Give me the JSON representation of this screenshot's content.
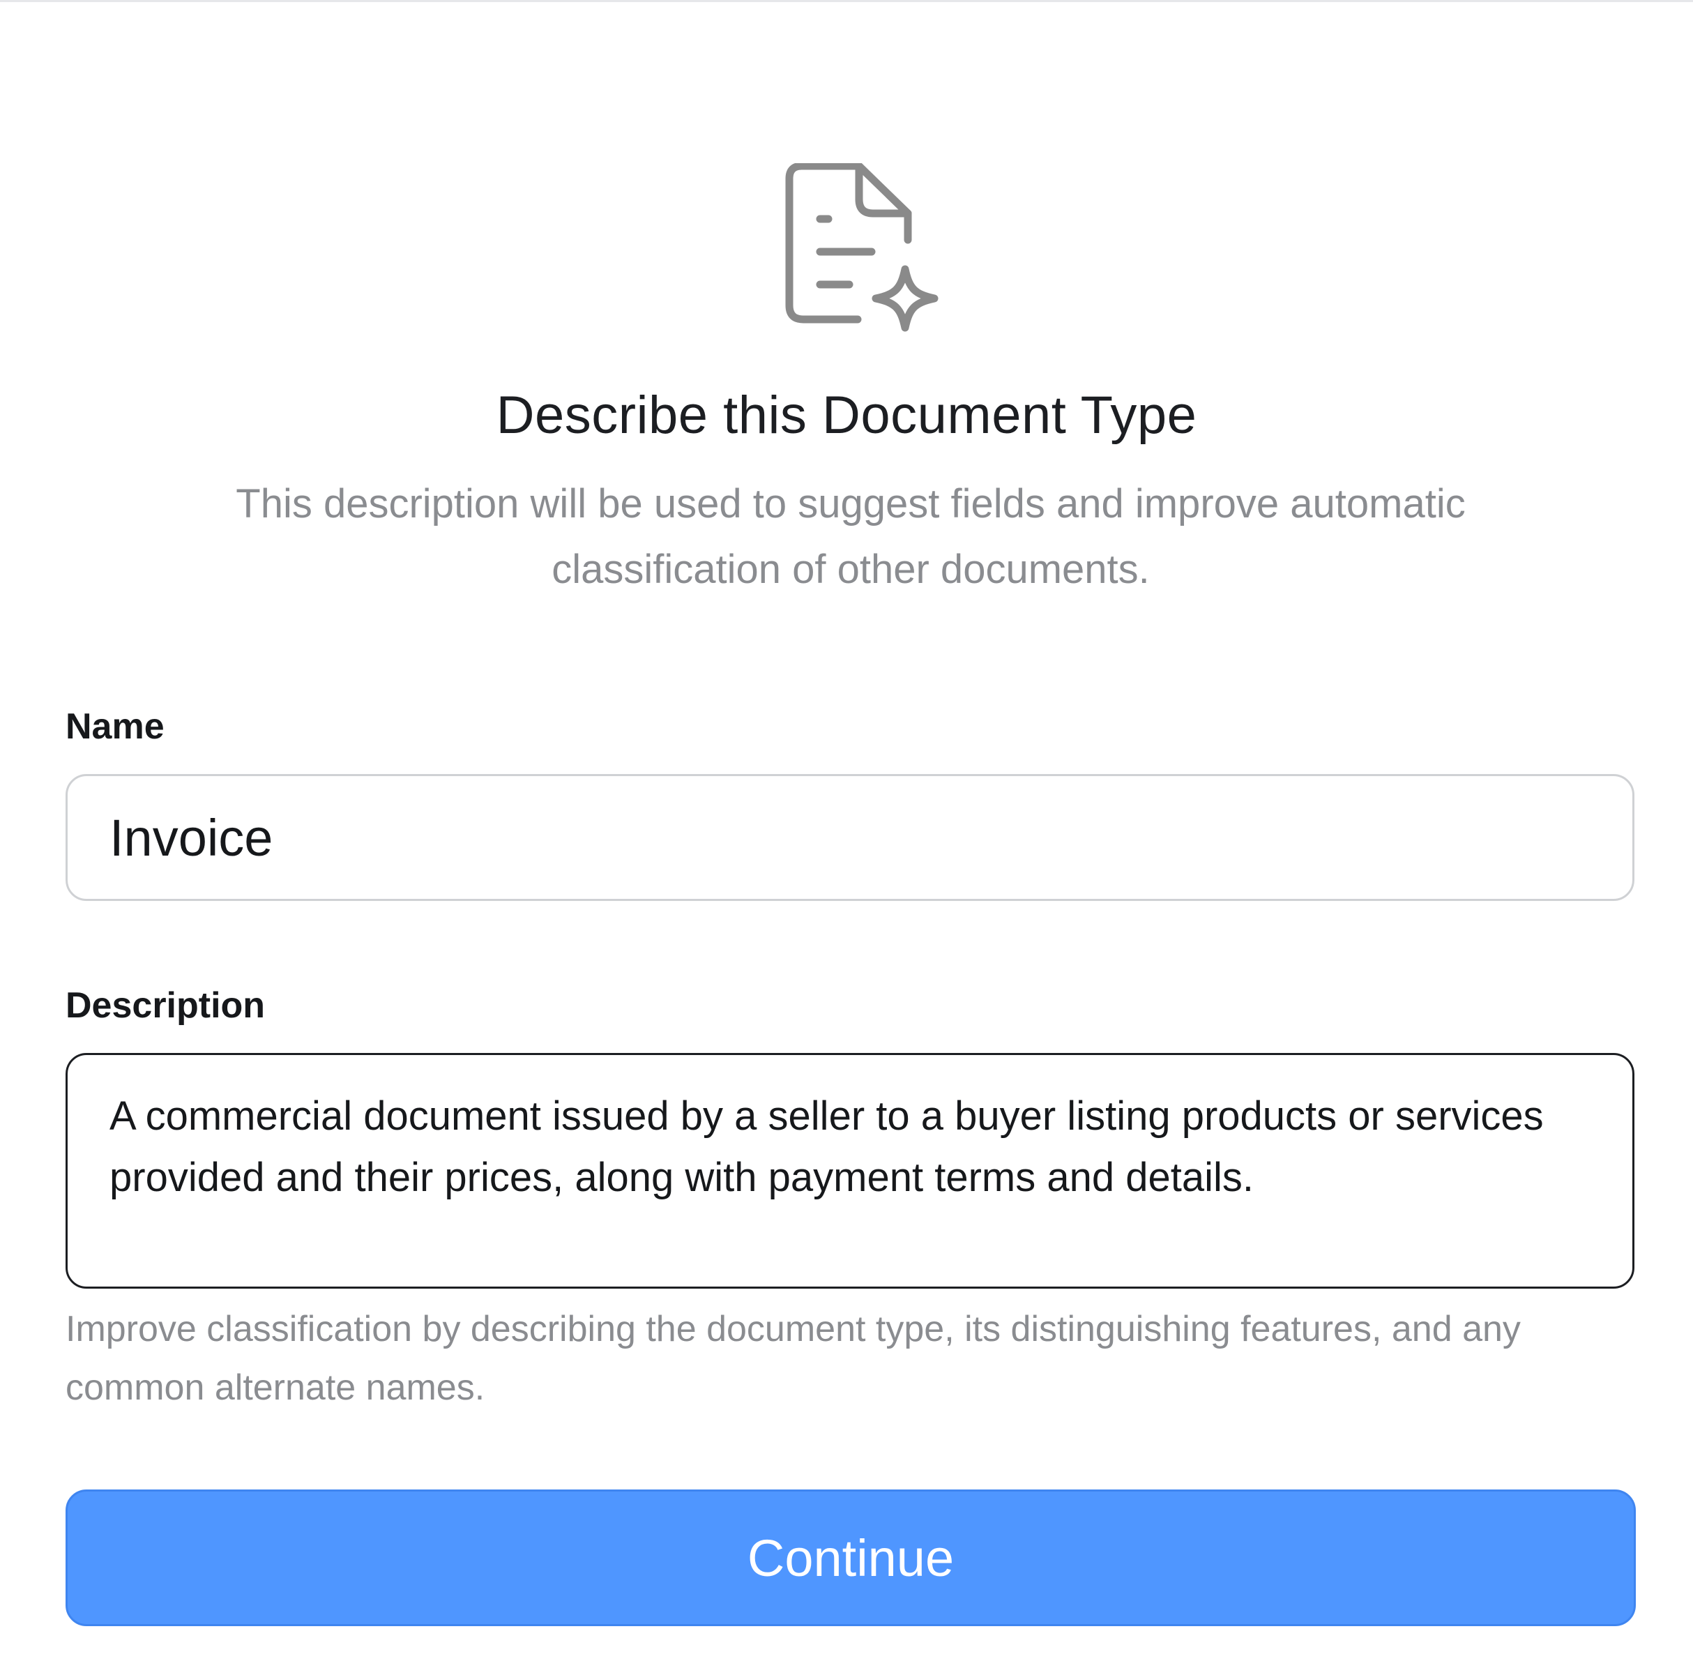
{
  "header": {
    "icon": "document-sparkle-icon",
    "title": "Describe this Document Type",
    "subtitle": "This description will be used to suggest fields and improve automatic classification of other documents."
  },
  "form": {
    "name_label": "Name",
    "name_value": "Invoice",
    "description_label": "Description",
    "description_value": "A commercial document issued by a seller to a buyer listing products or services provided and their prices, along with payment terms and details.",
    "description_helper": "Improve classification by describing the document type, its distinguishing features, and any common alternate names."
  },
  "actions": {
    "continue_label": "Continue"
  },
  "colors": {
    "accent": "#4f96ff",
    "text": "#16181b",
    "muted": "#8a8c90",
    "icon": "#8a8a8a"
  }
}
